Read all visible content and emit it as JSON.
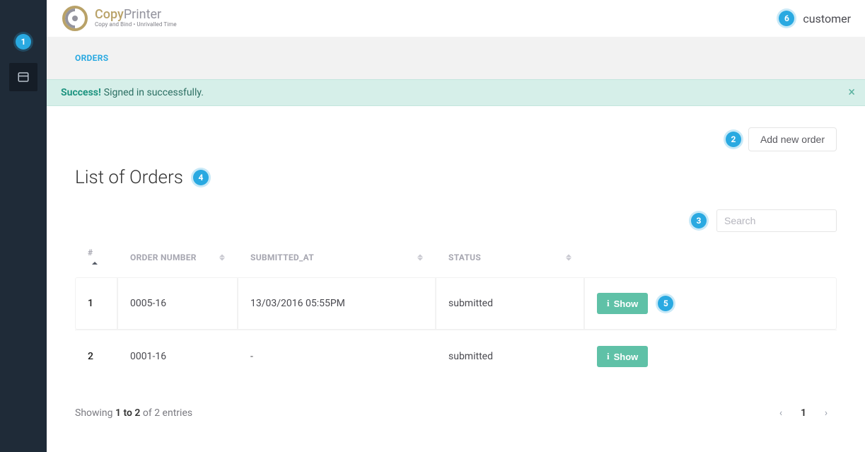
{
  "brand": {
    "name_a": "Copy",
    "name_b": "Printer",
    "tagline": "Copy and Bind • Unrivalled Time"
  },
  "user": {
    "label": "customer"
  },
  "breadcrumb": "ORDERS",
  "alert": {
    "strong": "Success!",
    "text": "Signed in successfully."
  },
  "actions": {
    "add_new": "Add new order"
  },
  "page": {
    "title": "List of Orders"
  },
  "search": {
    "placeholder": "Search"
  },
  "table": {
    "headers": {
      "idx": "#",
      "order_number": "ORDER NUMBER",
      "submitted_at": "SUBMITTED_AT",
      "status": "STATUS"
    },
    "rows": [
      {
        "idx": "1",
        "order_number": "0005-16",
        "submitted_at": "13/03/2016 05:55PM",
        "status": "submitted",
        "action": "Show"
      },
      {
        "idx": "2",
        "order_number": "0001-16",
        "submitted_at": "-",
        "status": "submitted",
        "action": "Show"
      }
    ]
  },
  "footer": {
    "prefix": "Showing ",
    "range": "1 to 2",
    "suffix": " of 2 entries"
  },
  "pager": {
    "page": "1"
  },
  "callouts": {
    "c1": "1",
    "c2": "2",
    "c3": "3",
    "c4": "4",
    "c5": "5",
    "c6": "6"
  }
}
